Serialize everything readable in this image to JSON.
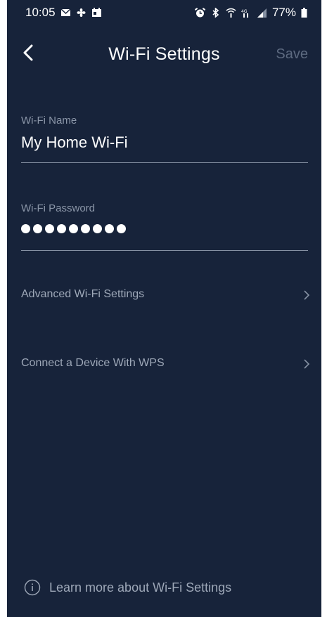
{
  "status_bar": {
    "time": "10:05",
    "battery": "77%",
    "left_icons": [
      "mail-icon",
      "fan-icon",
      "calendar-icon"
    ],
    "right_icons": [
      "alarm-icon",
      "bluetooth-icon",
      "wifi-call-icon",
      "lte-icon",
      "signal-icon",
      "battery-icon"
    ]
  },
  "header": {
    "title": "Wi-Fi Settings",
    "save_label": "Save",
    "back_icon": "chevron-left-icon"
  },
  "fields": {
    "wifi_name": {
      "label": "Wi-Fi Name",
      "value": "My Home Wi-Fi"
    },
    "wifi_password": {
      "label": "Wi-Fi Password",
      "masked_length": 9
    }
  },
  "menu": {
    "advanced": "Advanced Wi-Fi Settings",
    "wps": "Connect a Device With WPS"
  },
  "footer": {
    "link_text": "Learn more about Wi-Fi Settings",
    "icon": "info-icon"
  },
  "colors": {
    "background": "#17233a",
    "text_primary": "#ffffff",
    "text_secondary": "#9ea8b8",
    "disabled": "#5d6a80",
    "divider": "#8691a3"
  }
}
